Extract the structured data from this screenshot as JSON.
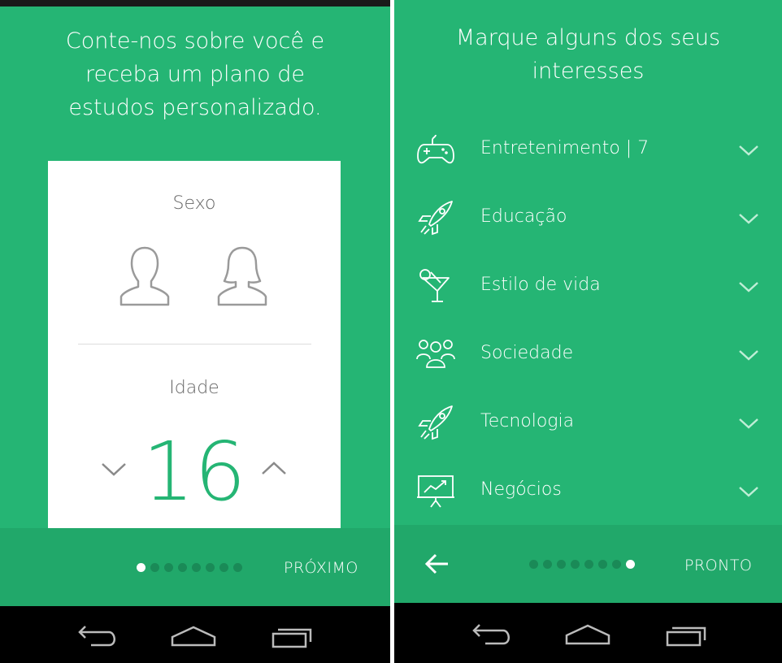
{
  "left": {
    "headline": [
      "Conte-nos sobre você e",
      "receba um plano de",
      "estudos personalizado."
    ],
    "card": {
      "sex_label": "Sexo",
      "age_label": "Idade",
      "age_value": "16"
    },
    "pager": {
      "total": 8,
      "active": 0
    },
    "next_label": "PRÓXIMO"
  },
  "right": {
    "headline": [
      "Marque alguns dos seus",
      "interesses"
    ],
    "categories": [
      {
        "label": "Entretenimento | 7",
        "icon": "gamepad-icon"
      },
      {
        "label": "Educação",
        "icon": "rocket-icon"
      },
      {
        "label": "Estilo de vida",
        "icon": "cocktail-icon"
      },
      {
        "label": "Sociedade",
        "icon": "people-group-icon"
      },
      {
        "label": "Tecnologia",
        "icon": "rocket-icon"
      },
      {
        "label": "Negócios",
        "icon": "presentation-chart-icon"
      }
    ],
    "pager": {
      "total": 8,
      "active": 7
    },
    "done_label": "PRONTO"
  },
  "colors": {
    "accent": "#25b574",
    "bottom_bar": "#21a86a",
    "dot_inactive": "#1a8a57",
    "nav_bar": "#000000"
  }
}
